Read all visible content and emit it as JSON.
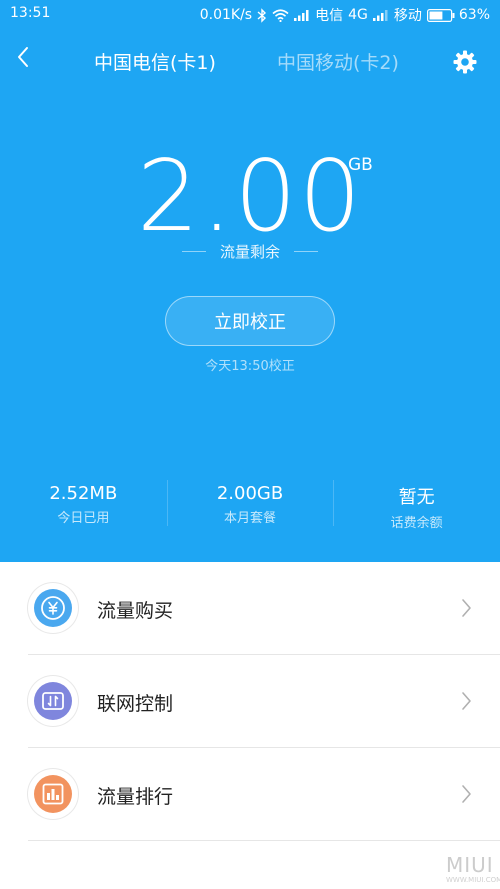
{
  "status_bar": {
    "time": "13:51",
    "speed": "0.01K/s",
    "carrier1": "电信",
    "network1": "4G",
    "carrier2": "移动",
    "battery": "63%",
    "battery_level": 0.63,
    "icons": [
      "bluetooth-icon",
      "wifi-icon",
      "signal-icon",
      "signal-icon",
      "battery-icon"
    ]
  },
  "header": {
    "tabs": [
      {
        "label": "中国电信(卡1)",
        "active": true
      },
      {
        "label": "中国移动(卡2)",
        "active": false
      }
    ],
    "back_icon": "chevron-left-icon",
    "settings_icon": "gear-icon"
  },
  "data_remaining": {
    "value": "2.00",
    "unit": "GB",
    "label": "流量剩余"
  },
  "calibrate": {
    "button_label": "立即校正",
    "last_calibrated": "今天13:50校正"
  },
  "stats": [
    {
      "value": "2.52MB",
      "label": "今日已用"
    },
    {
      "value": "2.00GB",
      "label": "本月套餐"
    },
    {
      "value": "暂无",
      "label": "话费余额"
    }
  ],
  "menu": [
    {
      "label": "流量购买",
      "icon": "yuan-icon",
      "color": "#4aa8ef"
    },
    {
      "label": "联网控制",
      "icon": "network-control-icon",
      "color": "#7f86dd"
    },
    {
      "label": "流量排行",
      "icon": "bar-chart-icon",
      "color": "#f2935f"
    }
  ],
  "watermark": {
    "text": "MIUI",
    "sub": "WWW.MIUI.COM"
  },
  "colors": {
    "accent": "#1ea6f3",
    "background": "#ffffff"
  }
}
